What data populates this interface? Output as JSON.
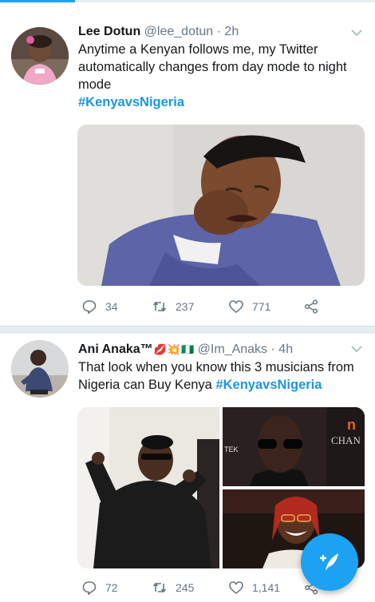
{
  "tweets": [
    {
      "name": "Lee Dotun",
      "handle": "@lee_dotun",
      "time": "· 2h",
      "text": "Anytime a Kenyan follows me, my Twitter automatically changes from day mode to night mode",
      "hashtag": "#KenyavsNigeria",
      "actions": {
        "replies": "34",
        "retweets": "237",
        "likes": "771"
      }
    },
    {
      "name": "Ani Anaka™",
      "name_emojis": [
        "💋",
        "💥",
        "🇳🇬"
      ],
      "handle": "@Im_Anaks",
      "time": "· 4h",
      "text": "That look when you know this 3 musicians from Nigeria can Buy Kenya ",
      "hashtag": "#KenyavsNigeria",
      "actions": {
        "replies": "72",
        "retweets": "245",
        "likes": "1,141"
      },
      "media_text": {
        "tecno": "TEK",
        "chandon": "CHAN",
        "n_logo": "n"
      }
    }
  ],
  "colors": {
    "accent": "#1da1f2",
    "link": "#1b95e0",
    "muted": "#657786"
  },
  "icons": [
    "caret-down-icon",
    "reply-icon",
    "retweet-icon",
    "like-icon",
    "share-icon",
    "compose-tweet-icon"
  ]
}
